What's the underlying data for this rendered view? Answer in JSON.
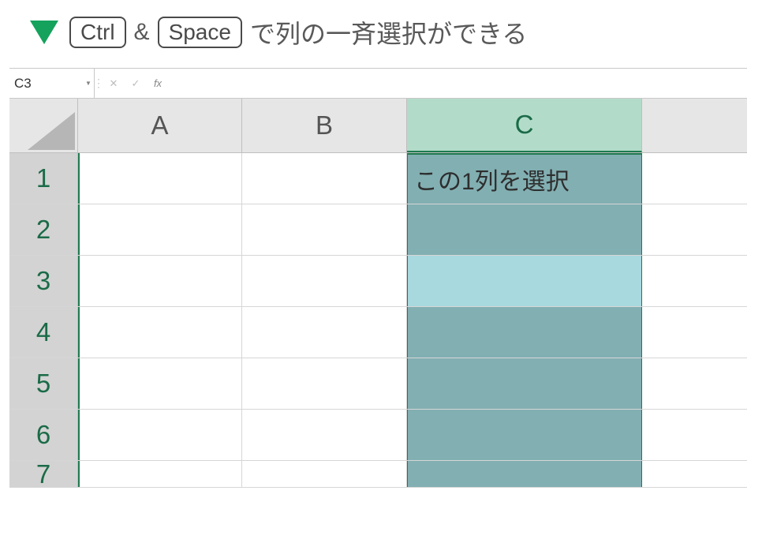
{
  "instruction": {
    "key1": "Ctrl",
    "amp": "&",
    "key2": "Space",
    "text": "で列の一斉選択ができる"
  },
  "nameBox": "C3",
  "fx": "fx",
  "columns": {
    "A": "A",
    "B": "B",
    "C": "C",
    "D": ""
  },
  "rows": {
    "r1": "1",
    "r2": "2",
    "r3": "3",
    "r4": "4",
    "r5": "5",
    "r6": "6",
    "r7": "7"
  },
  "cells": {
    "C1": "この1列を選択"
  },
  "state": {
    "activeCell": "C3",
    "selectedColumn": "C"
  }
}
